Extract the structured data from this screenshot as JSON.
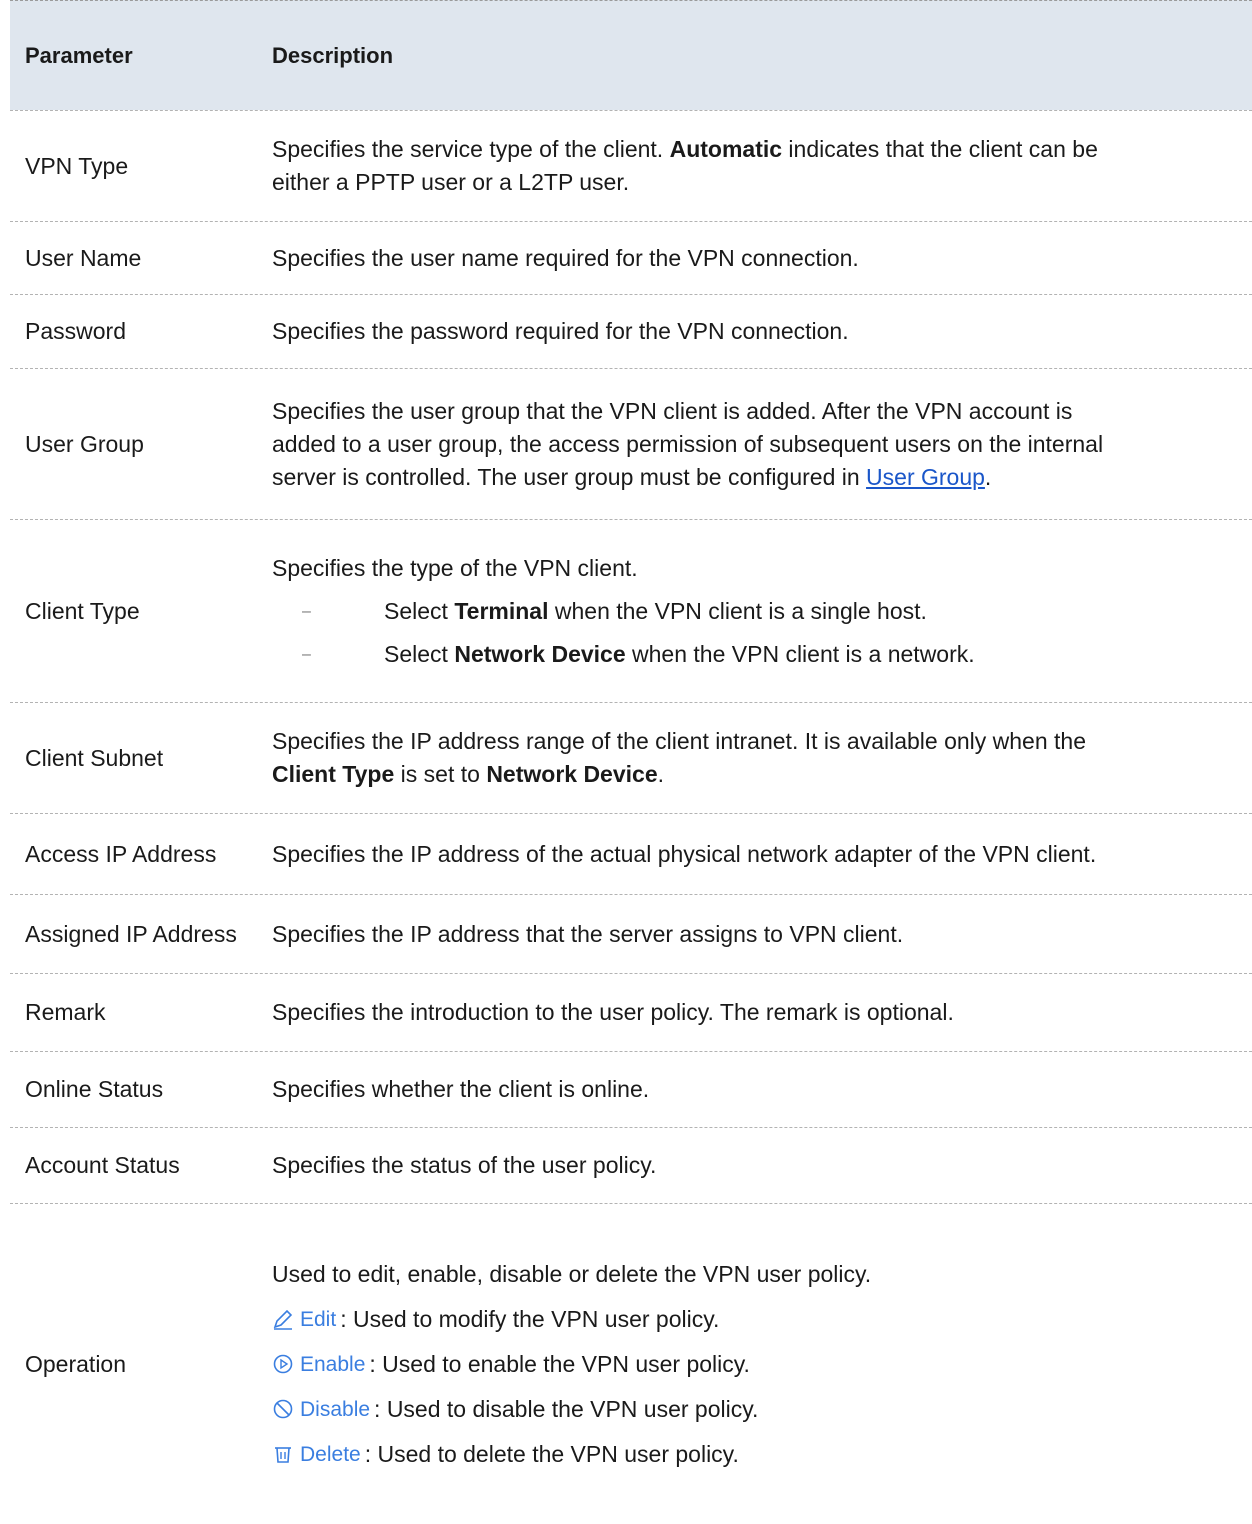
{
  "table": {
    "header": {
      "param": "Parameter",
      "desc": "Description"
    },
    "rows": {
      "vpn_type": {
        "param": "VPN Type",
        "d1": "Specifies the service type of the client. ",
        "d1_bold": "Automatic",
        "d1_rest": " indicates that the client can be",
        "d2": "either a PPTP user or a L2TP user."
      },
      "user_name": {
        "param": "User Name",
        "desc": "Specifies the user name required for the VPN connection."
      },
      "password": {
        "param": "Password",
        "desc": "Specifies the password required for the VPN connection."
      },
      "user_group": {
        "param": "User Group",
        "d1": "Specifies the user group that the VPN client is added. After the VPN account is",
        "d2": "added to a user group, the access permission of subsequent users on the internal",
        "d3": "server is controlled. The user group must be configured in ",
        "link": "User Group",
        "d3_end": "."
      },
      "client_type": {
        "param": "Client Type",
        "d1": "Specifies the type of the VPN client.",
        "b1_pre": "Select ",
        "b1_bold": "Terminal",
        "b1_rest": " when the VPN client is a single host.",
        "b2_pre": "Select ",
        "b2_bold": "Network Device",
        "b2_rest": " when the VPN client is a network.",
        "dash": "–"
      },
      "client_subnet": {
        "param": "Client Subnet",
        "d1": "Specifies the IP address range of the client intranet. It is available only when the",
        "b1": "Client Type",
        "mid": " is set to ",
        "b2": "Network Device",
        "end": "."
      },
      "access_ip": {
        "param": "Access IP Address",
        "desc": "Specifies the IP address of the actual physical network adapter of the VPN client."
      },
      "assigned_ip": {
        "param": "Assigned IP Address",
        "desc": "Specifies the IP address that the server assigns to VPN client."
      },
      "remark": {
        "param": "Remark",
        "desc": "Specifies the introduction to the user policy. The remark is optional."
      },
      "online_status": {
        "param": "Online Status",
        "desc": "Specifies whether the client is online."
      },
      "account_status": {
        "param": "Account Status",
        "desc": "Specifies the status of the user policy."
      },
      "operation": {
        "param": "Operation",
        "d1": "Used to edit, enable, disable or delete the VPN user policy.",
        "edit_label": "Edit",
        "edit_desc": ": Used to modify the VPN user policy.",
        "enable_label": "Enable",
        "enable_desc": ": Used to enable the VPN user policy.",
        "disable_label": "Disable",
        "disable_desc": ": Used to disable the VPN user policy.",
        "delete_label": "Delete",
        "delete_desc": ": Used to delete the VPN user policy."
      }
    }
  },
  "colors": {
    "header_bg": "#dfe6ee",
    "link": "#1a56c9",
    "icon_blue": "#3a7ee0"
  },
  "icons": [
    "pencil-icon",
    "play-circle-icon",
    "ban-icon",
    "trash-icon"
  ]
}
